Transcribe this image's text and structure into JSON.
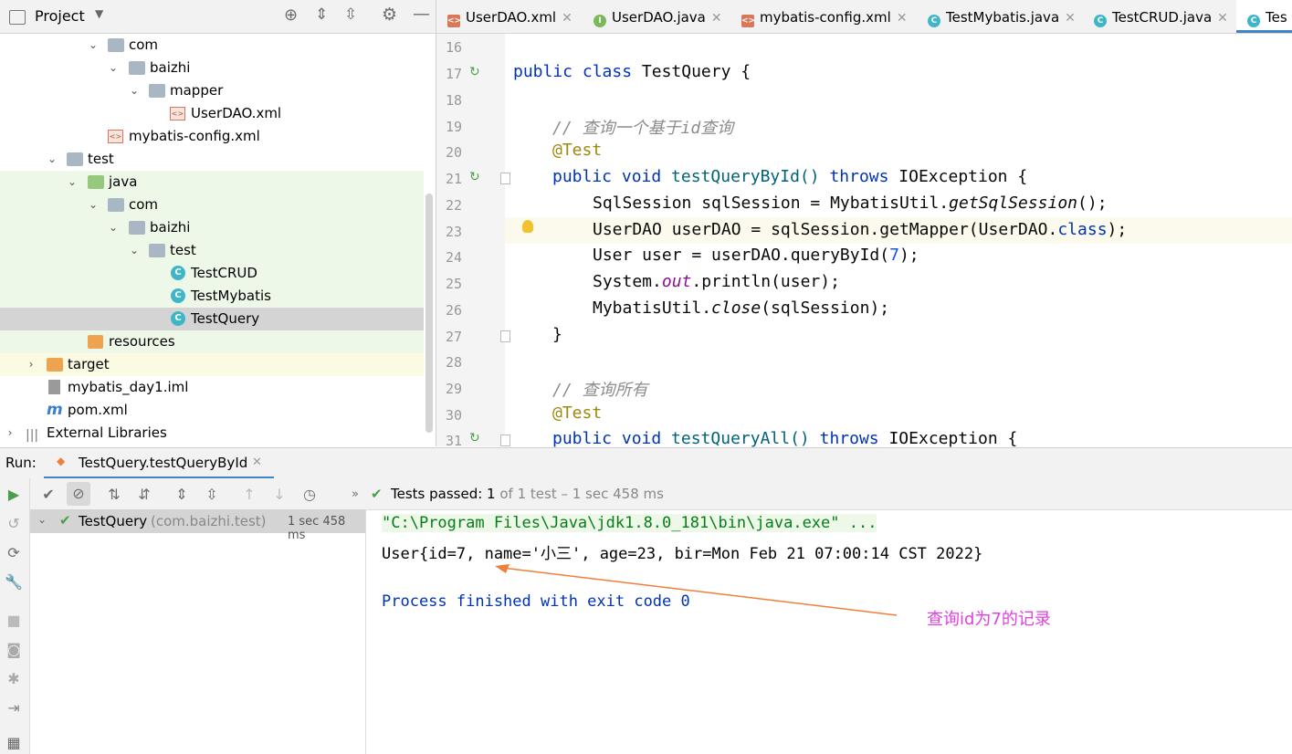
{
  "project": {
    "title": "Project",
    "tree": [
      {
        "label": "com"
      },
      {
        "label": "baizhi"
      },
      {
        "label": "mapper"
      },
      {
        "label": "UserDAO.xml"
      },
      {
        "label": "mybatis-config.xml"
      },
      {
        "label": "test"
      },
      {
        "label": "java"
      },
      {
        "label": "com"
      },
      {
        "label": "baizhi"
      },
      {
        "label": "test"
      },
      {
        "label": "TestCRUD"
      },
      {
        "label": "TestMybatis"
      },
      {
        "label": "TestQuery"
      },
      {
        "label": "resources"
      },
      {
        "label": "target"
      },
      {
        "label": "mybatis_day1.iml"
      },
      {
        "label": "pom.xml"
      },
      {
        "label": "External Libraries"
      }
    ]
  },
  "editor": {
    "tabs": [
      {
        "label": "UserDAO.xml"
      },
      {
        "label": "UserDAO.java"
      },
      {
        "label": "mybatis-config.xml"
      },
      {
        "label": "TestMybatis.java"
      },
      {
        "label": "TestCRUD.java"
      },
      {
        "label": "Tes"
      }
    ],
    "line_numbers": [
      "16",
      "17",
      "18",
      "19",
      "20",
      "21",
      "22",
      "23",
      "24",
      "25",
      "26",
      "27",
      "28",
      "29",
      "30",
      "31"
    ],
    "code": {
      "l17a": "public class ",
      "l17b": "TestQuery {",
      "l19": "// 查询一个基于id查询",
      "l20": "@Test",
      "l21a": "public void ",
      "l21b": "testQueryById() ",
      "l21c": "throws ",
      "l21d": "IOException {",
      "l22a": "SqlSession sqlSession = MybatisUtil.",
      "l22b": "getSqlSession",
      "l22c": "();",
      "l23a": "UserDAO userDAO = sqlSession.getMapper(UserDAO.",
      "l23b": "class",
      "l23c": ");",
      "l24a": "User user = userDAO.queryById(",
      "l24b": "7",
      "l24c": ");",
      "l25a": "System.",
      "l25b": "out",
      "l25c": ".println(user);",
      "l26a": "MybatisUtil.",
      "l26b": "close",
      "l26c": "(sqlSession);",
      "l27": "}",
      "l29": "// 查询所有",
      "l30": "@Test",
      "l31a": "public void ",
      "l31b": "testQueryAll() ",
      "l31c": "throws ",
      "l31d": "IOException {"
    }
  },
  "run": {
    "label": "Run:",
    "tab_label": "TestQuery.testQueryById",
    "status_prefix": "Tests passed: ",
    "status_count": "1",
    "status_suffix": " of 1 test – 1 sec 458 ms",
    "test_name": "TestQuery",
    "test_package": "(com.baizhi.test)",
    "test_time": "1 sec 458 ms",
    "output": {
      "cmd": "\"C:\\Program Files\\Java\\jdk1.8.0_181\\bin\\java.exe\" ...",
      "result": "User{id=7, name='小三', age=23, bir=Mon Feb 21 07:00:14 CST 2022}",
      "exit": "Process finished with exit code 0"
    },
    "annotation": "查询id为7的记录"
  },
  "colors": {
    "accent": "#4083c9",
    "pass": "#4a9e4a",
    "annotation": "#e040e0",
    "arrow": "#f07f3a"
  }
}
